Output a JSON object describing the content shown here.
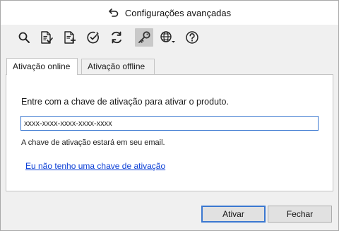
{
  "window": {
    "title": "Configurações avançadas",
    "title_icon": "back-arrow-icon"
  },
  "toolbar": {
    "items": [
      {
        "icon": "search-icon",
        "active": false
      },
      {
        "icon": "document-check-icon",
        "active": false
      },
      {
        "icon": "document-add-icon",
        "active": false
      },
      {
        "icon": "clock-check-icon",
        "active": false
      },
      {
        "icon": "refresh-icon",
        "active": false
      },
      {
        "icon": "key-icon",
        "active": true
      },
      {
        "icon": "globe-dropdown-icon",
        "active": false
      },
      {
        "icon": "help-icon",
        "active": false
      }
    ]
  },
  "tabs": [
    {
      "label": "Ativação online",
      "active": true
    },
    {
      "label": "Ativação offline",
      "active": false
    }
  ],
  "panel": {
    "prompt": "Entre com a chave de ativação para ativar o produto.",
    "key_input": {
      "value": "xxxx-xxxx-xxxx-xxxx-xxxx",
      "placeholder": ""
    },
    "hint": "A chave de ativação estará em seu email.",
    "link": "Eu não tenho uma chave de ativação"
  },
  "buttons": {
    "activate": "Ativar",
    "close": "Fechar"
  },
  "colors": {
    "accent": "#3b78d0",
    "link": "#0b3fd6",
    "window_bg": "#f0f0f0",
    "active_tool_bg": "#c9c9c9"
  }
}
